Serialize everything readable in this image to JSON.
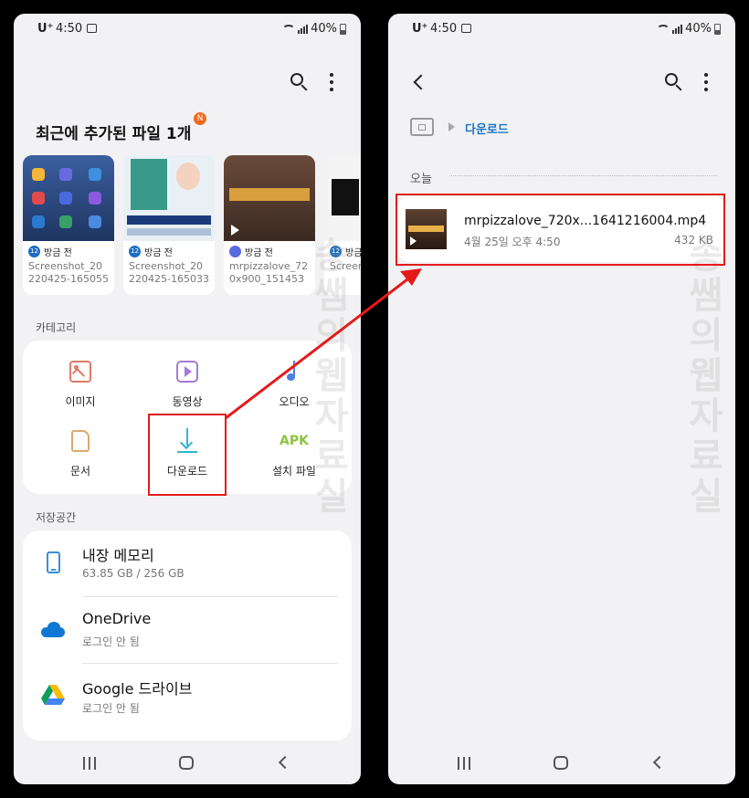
{
  "status": {
    "carrier": "U⁺",
    "time": "4:50",
    "battery": "40%"
  },
  "left": {
    "recent_title": "최근에 추가된 파일 1개",
    "new_badge": "N",
    "recent_cards": [
      {
        "when": "방금 전",
        "app_badge": "12",
        "name": "Screenshot_20220425-165055_..."
      },
      {
        "when": "방금 전",
        "app_badge": "12",
        "name": "Screenshot_20220425-165033_..."
      },
      {
        "when": "방금 전",
        "app_badge": "",
        "name": "mrpizzalove_720x900_1514532..."
      },
      {
        "when": "방금 전",
        "app_badge": "12",
        "name": "Screen..."
      }
    ],
    "category_label": "카테고리",
    "categories": [
      {
        "label": "이미지",
        "icon": "image-icon",
        "color": "#e07a66"
      },
      {
        "label": "동영상",
        "icon": "video-icon",
        "color": "#a37bd6"
      },
      {
        "label": "오디오",
        "icon": "audio-icon",
        "color": "#4f7fe0"
      },
      {
        "label": "문서",
        "icon": "document-icon",
        "color": "#d9a96a"
      },
      {
        "label": "다운로드",
        "icon": "download-icon",
        "color": "#2fb5c9"
      },
      {
        "label": "설치 파일",
        "icon": "apk-icon",
        "apk_text": "APK",
        "color": "#8ac43f"
      }
    ],
    "storage_label": "저장공간",
    "storage": [
      {
        "title": "내장 메모리",
        "sub": "63.85 GB / 256 GB",
        "icon": "phone-storage-icon"
      },
      {
        "title": "OneDrive",
        "sub": "로그인 안 됨",
        "icon": "onedrive-icon"
      },
      {
        "title": "Google 드라이브",
        "sub": "로그인 안 됨",
        "icon": "google-drive-icon"
      }
    ]
  },
  "right": {
    "breadcrumb": "다운로드",
    "date_group": "오늘",
    "file": {
      "name": "mrpizzalove_720x...1641216004.mp4",
      "date": "4월 25일 오후 4:50",
      "size": "432 KB"
    }
  },
  "watermark": "송쌤의웹자료실",
  "colors": {
    "highlight": "#e31b1b",
    "accent_blue": "#1a73c8",
    "badge_orange": "#f36a1f"
  }
}
